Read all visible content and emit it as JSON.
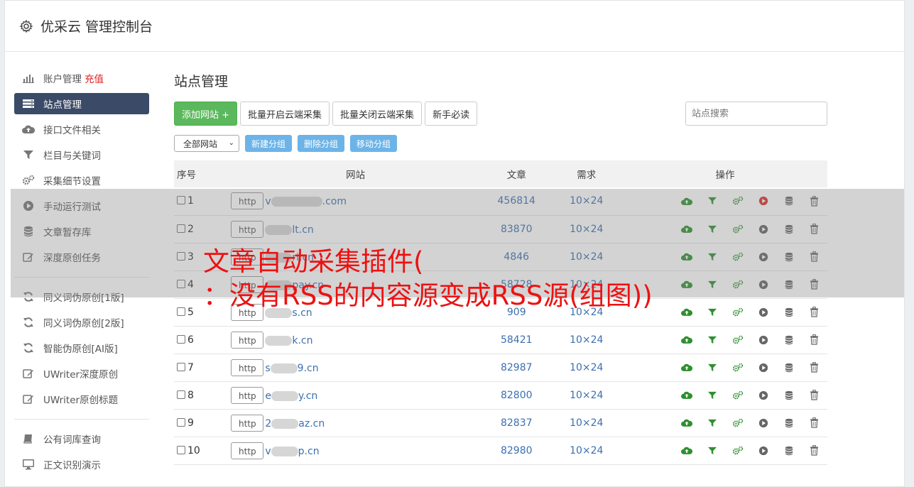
{
  "app": {
    "title": "优采云 管理控制台"
  },
  "sidebar": {
    "items": [
      {
        "label": "账户管理",
        "badge": "充值",
        "icon": "bar-chart-icon"
      },
      {
        "label": "站点管理",
        "icon": "server-icon",
        "active": true
      },
      {
        "label": "接口文件相关",
        "icon": "cloud-upload-icon"
      },
      {
        "label": "栏目与关键词",
        "icon": "filter-icon"
      },
      {
        "label": "采集细节设置",
        "icon": "gears-icon"
      },
      {
        "label": "手动运行测试",
        "icon": "play-circle-icon"
      },
      {
        "label": "文章暂存库",
        "icon": "database-icon"
      },
      {
        "label": "深度原创任务",
        "icon": "edit-icon"
      }
    ],
    "items2": [
      {
        "label": "同义词伪原创[1版]",
        "icon": "refresh-icon"
      },
      {
        "label": "同义词伪原创[2版]",
        "icon": "refresh-icon"
      },
      {
        "label": "智能伪原创[AI版]",
        "icon": "refresh-icon"
      },
      {
        "label": "UWriter深度原创",
        "icon": "edit-icon"
      },
      {
        "label": "UWriter原创标题",
        "icon": "edit-icon"
      }
    ],
    "items3": [
      {
        "label": "公有词库查询",
        "icon": "book-icon"
      },
      {
        "label": "正文识别演示",
        "icon": "monitor-icon"
      }
    ]
  },
  "main": {
    "title": "站点管理",
    "toolbar": {
      "add_site": "添加网站 +",
      "batch_open": "批量开启云端采集",
      "batch_close": "批量关闭云端采集",
      "newbie": "新手必读",
      "search_placeholder": "站点搜索"
    },
    "groups": {
      "select_value": "全部网站",
      "new_group": "新建分组",
      "delete_group": "删除分组",
      "move_group": "移动分组"
    },
    "table": {
      "headers": {
        "index": "序号",
        "site": "网站",
        "articles": "文章",
        "demand": "需求",
        "ops": "操作"
      },
      "rows": [
        {
          "index": "1",
          "scheme": "http",
          "site_pre": "v",
          "site_post": ".com",
          "articles": "456814",
          "demand": "10×24"
        },
        {
          "index": "2",
          "scheme": "http",
          "site_pre": "",
          "site_post": "lt.cn",
          "articles": "83870",
          "demand": "10×24"
        },
        {
          "index": "3",
          "scheme": "http",
          "site_pre": "",
          "site_post": "ri.cn",
          "articles": "4846",
          "demand": "10×24"
        },
        {
          "index": "4",
          "scheme": "http",
          "site_pre": "",
          "site_post": "pay.cn",
          "articles": "58728",
          "demand": "10×24"
        },
        {
          "index": "5",
          "scheme": "http",
          "site_pre": "",
          "site_post": "s.cn",
          "articles": "909",
          "demand": "10×24"
        },
        {
          "index": "6",
          "scheme": "http",
          "site_pre": "",
          "site_post": "k.cn",
          "articles": "58421",
          "demand": "10×24"
        },
        {
          "index": "7",
          "scheme": "http",
          "site_pre": "s",
          "site_post": "9.cn",
          "articles": "82987",
          "demand": "10×24"
        },
        {
          "index": "8",
          "scheme": "http",
          "site_pre": "e",
          "site_post": "y.cn",
          "articles": "82800",
          "demand": "10×24"
        },
        {
          "index": "9",
          "scheme": "http",
          "site_pre": "2",
          "site_post": "az.cn",
          "articles": "82837",
          "demand": "10×24"
        },
        {
          "index": "10",
          "scheme": "http",
          "site_pre": "v",
          "site_post": "p.cn",
          "articles": "82980",
          "demand": "10×24"
        }
      ]
    }
  },
  "overlay": {
    "line1": "文章自动采集插件(",
    "line2": "：没有RSS的内容源变成RSS源(组图))"
  },
  "colors": {
    "accent_green": "#5cb85c",
    "sidebar_active": "#3b4a66",
    "link_blue": "#3b6fb0",
    "overlay_red": "#ee1111"
  }
}
